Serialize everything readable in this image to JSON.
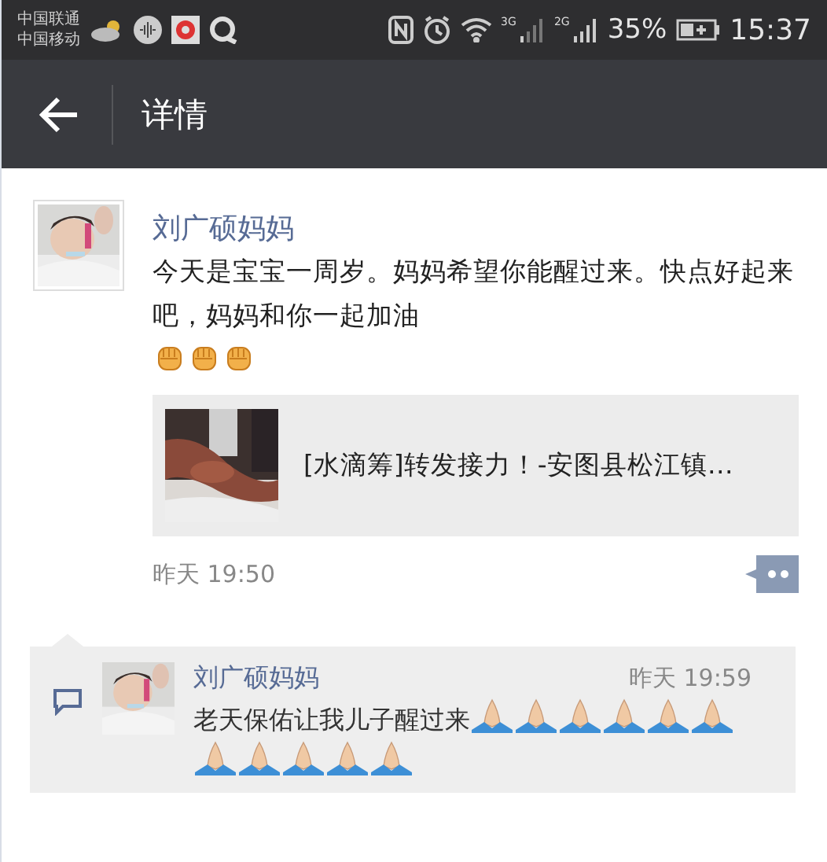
{
  "status_bar": {
    "carriers": [
      "中国联通",
      "中国移动"
    ],
    "network_1": "3G",
    "network_2": "2G",
    "battery": "35%",
    "time": "15:37"
  },
  "header": {
    "title": "详情"
  },
  "post": {
    "author": "刘广硕妈妈",
    "text": "今天是宝宝一周岁。妈妈希望你能醒过来。快点好起来吧，妈妈和你一起加油",
    "link": {
      "kind": "picture",
      "title": "[水滴筹]转发接力！-安图县松江镇…"
    },
    "time": "昨天 19:50"
  },
  "comments": [
    {
      "author": "刘广硕妈妈",
      "time": "昨天 19:59",
      "text": "老天保佑让我儿子醒过来"
    }
  ]
}
